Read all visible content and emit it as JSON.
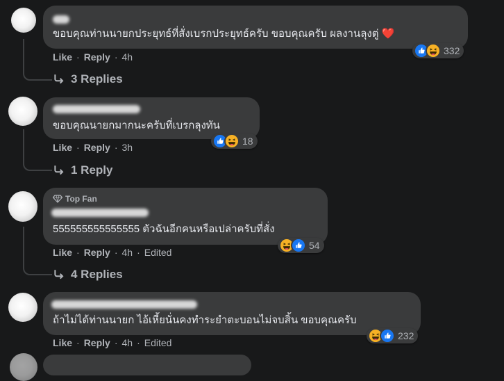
{
  "comments": [
    {
      "text": "ขอบคุณท่านนายกประยุทธ์ที่สั่งเบรกประยุทธ์ครับ ขอบคุณครับ ผลงานลุงตู่",
      "heart": "❤️",
      "like_label": "Like",
      "reply_label": "Reply",
      "time": "4h",
      "reaction_count": "332",
      "replies_label": "3 Replies"
    },
    {
      "text": "ขอบคุณนายกมากนะครับที่เบรกลุงทัน",
      "like_label": "Like",
      "reply_label": "Reply",
      "time": "3h",
      "reaction_count": "18",
      "replies_label": "1 Reply"
    },
    {
      "badge": "Top Fan",
      "text": "555555555555555 ตัวฉันอีกคนหรือเปล่าครับที่สั่ง",
      "like_label": "Like",
      "reply_label": "Reply",
      "time": "4h",
      "edited": "Edited",
      "reaction_count": "54",
      "replies_label": "4 Replies"
    },
    {
      "text": "ถ้าไม่ได้ท่านนายก ไอ้เหี้ยนั่นคงทำระยำตะบอนไม่จบสิ้น ขอบคุณครับ",
      "like_label": "Like",
      "reply_label": "Reply",
      "time": "4h",
      "edited": "Edited",
      "reaction_count": "232"
    }
  ],
  "colors": {
    "background": "#18191a",
    "bubble": "#3a3b3c",
    "text": "#e4e6eb",
    "secondary": "#b0b3b8",
    "like_blue": "#1877f2",
    "haha_yellow": "#f7b125"
  },
  "icons": {
    "like": "like-thumb-icon",
    "haha": "haha-face-icon",
    "reply_arrow": "reply-arrow-icon",
    "top_fan": "diamond-icon"
  }
}
